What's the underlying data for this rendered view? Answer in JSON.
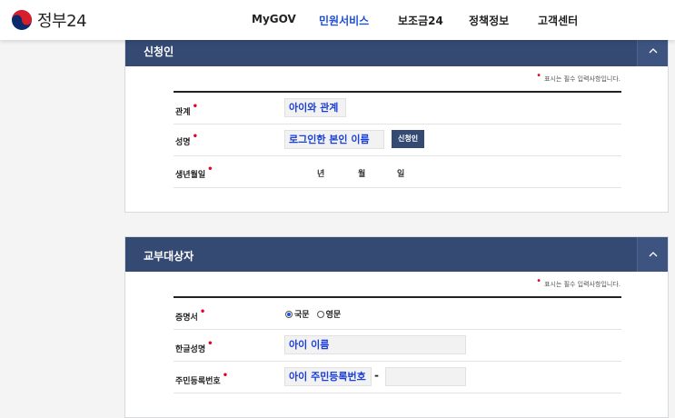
{
  "brand": {
    "logo_text": "정부24"
  },
  "nav": [
    {
      "label": "MyGOV",
      "active": false
    },
    {
      "label": "민원서비스",
      "active": true
    },
    {
      "label": "보조금24",
      "active": false
    },
    {
      "label": "정책정보",
      "active": false
    },
    {
      "label": "고객센터",
      "active": false
    }
  ],
  "applicant": {
    "title": "신청인",
    "required_note": "표시는 필수 입력사항입니다.",
    "relation_label": "관계",
    "relation_value": "아이와 관계",
    "name_label": "성명",
    "name_value": "로그인한 본인 이름",
    "apply_button": "신청인",
    "birth_label": "생년월일",
    "birth_year_unit": "년",
    "birth_month_unit": "월",
    "birth_day_unit": "일"
  },
  "target": {
    "title": "교부대상자",
    "required_note": "표시는 필수 입력사항입니다.",
    "certificate_label": "증명서",
    "lang_korean": "국문",
    "lang_english": "영문",
    "selected_lang": "국문",
    "korean_name_label": "한글성명",
    "korean_name_value": "아이 이름",
    "rrn_label": "주민등록번호",
    "rrn_value": "아이 주민등록번호",
    "rrn_separator": "-"
  },
  "colors": {
    "panel_header": "#354a73",
    "accent_blue": "#1e4fd6",
    "required_red": "#e4002b"
  }
}
